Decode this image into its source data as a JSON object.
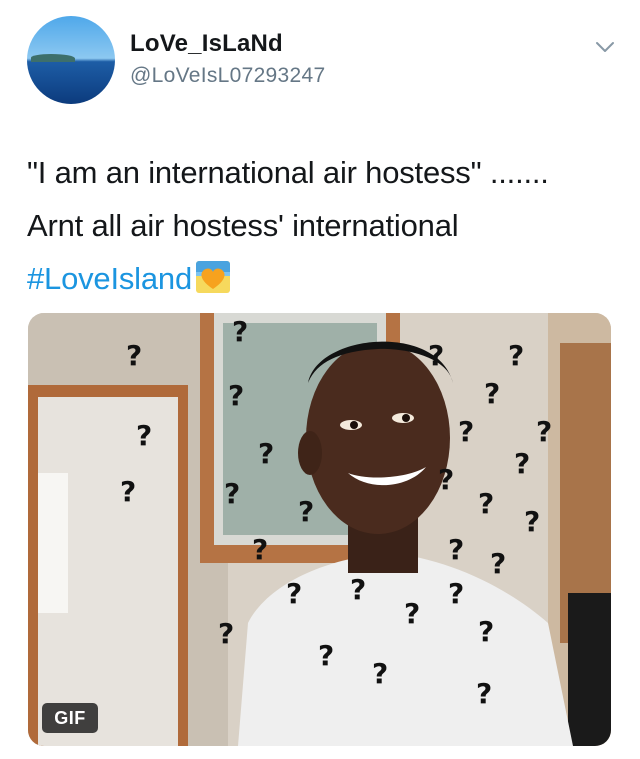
{
  "tweet": {
    "display_name": "LoVe_IsLaNd",
    "handle": "@LoVeIsL07293247",
    "text_lines": [
      "\"I am an international air hostess\" .......",
      "Arnt all air hostess' international"
    ],
    "hashtag": "#LoveIsland",
    "hashtag_emoji": "orange-heart-emoji-icon",
    "media": {
      "kind": "animated-gif",
      "badge_label": "GIF",
      "depicts": "man-smiling-with-question-marks"
    },
    "menu_icon": "chevron-down-icon",
    "colors": {
      "name": "#14171a",
      "handle": "#657786",
      "hashtag": "#1b95e0",
      "accent_heart": "#f7a21e"
    }
  }
}
